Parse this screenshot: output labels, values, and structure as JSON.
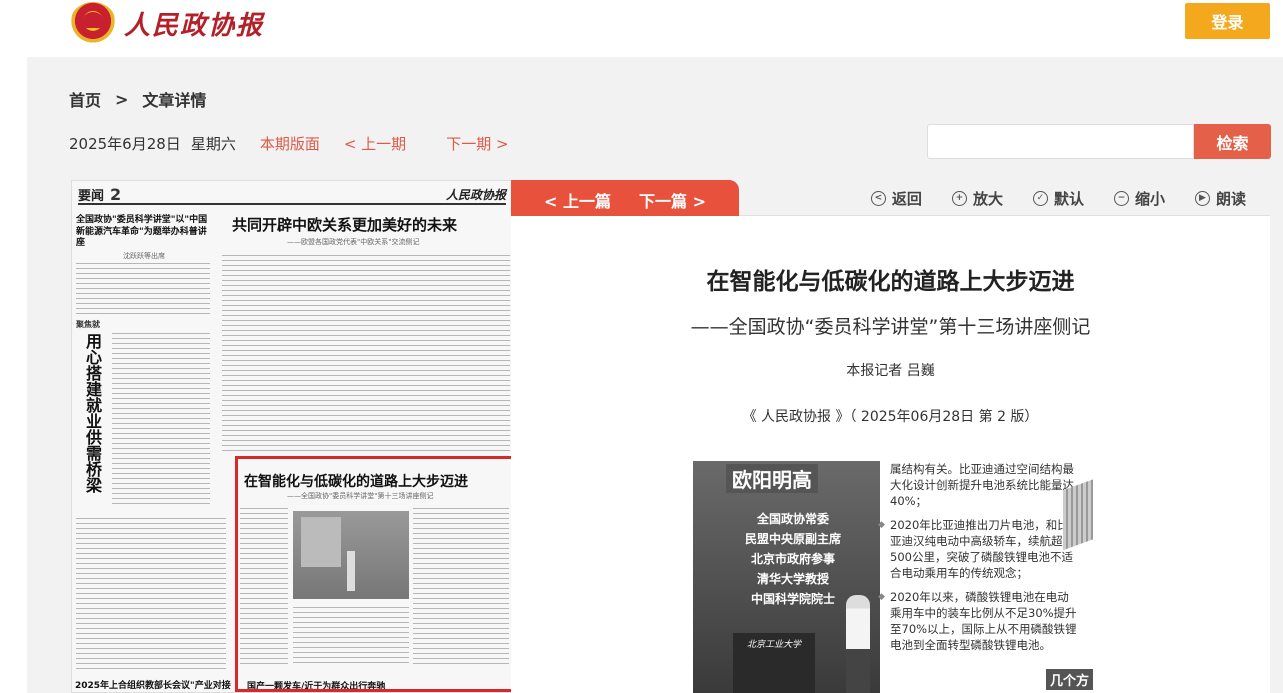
{
  "header": {
    "logo_text": "人民政协报",
    "login_label": "登录"
  },
  "breadcrumb": {
    "home": "首页",
    "separator": ">",
    "current": "文章详情"
  },
  "datebar": {
    "date": "2025年6月28日",
    "weekday": "星期六",
    "layout_link": "本期版面",
    "prev_issue": "< 上一期",
    "next_issue": "下一期 >"
  },
  "search": {
    "placeholder": "",
    "button_label": "检索"
  },
  "paper_page": {
    "section": "要闻",
    "page_number": "2",
    "masthead": "人民政协报",
    "headline_top": "共同开辟中欧关系更加美好的未来",
    "headline_top_sub": "——欧盟各国政党代表\"中欧关系\"交流侧记",
    "left_headline": "全国政协\"委员科学讲堂\"以\"中国新能源汽车革命\"为题举办科普讲座",
    "left_headline_sub": "沈跃跃等出席",
    "tag": "聚焦就",
    "vertical_title": "用心搭建就业供需桥梁",
    "headline_selected": "在智能化与低碳化的道路上大步迈进",
    "headline_selected_sub": "——全国政协\"委员科学讲堂\"第十三场讲座侧记",
    "bottom_left": "2025年上合组织教部长会议\"产业对接",
    "bottom_right": "国产一颗发车/近于为群众出行奔驰"
  },
  "article_toolbar": {
    "prev_article": "< 上一篇",
    "next_article": "下一篇 >",
    "tools": [
      {
        "icon": "back-icon",
        "glyph": "<",
        "label": "返回"
      },
      {
        "icon": "zoom-in-icon",
        "glyph": "+",
        "label": "放大"
      },
      {
        "icon": "default-icon",
        "glyph": "✓",
        "label": "默认"
      },
      {
        "icon": "zoom-out-icon",
        "glyph": "−",
        "label": "缩小"
      },
      {
        "icon": "play-icon",
        "glyph": "▶",
        "label": "朗读"
      }
    ]
  },
  "article": {
    "title": "在智能化与低碳化的道路上大步迈进",
    "subtitle": "——全国政协“委员科学讲堂”第十三场讲座侧记",
    "author": "本报记者 吕巍",
    "source": "《 人民政协报 》（ 2025年06月28日 第 2 版）"
  },
  "article_image": {
    "speaker_name": "欧阳明高",
    "speaker_titles": [
      "全国政协常委",
      "民盟中央原副主席",
      "北京市政府参事",
      "清华大学教授",
      "中国科学院院士"
    ],
    "podium_text": "北京工业大学",
    "slide_text_1": "属结构有关。比亚迪通过空间结构最大化设计创新提升电池系统比能量达40%；",
    "slide_text_2": "2020年比亚迪推出刀片电池，和比亚迪汉纯电动中高级轿车，续航超过500公里，突破了磷酸铁锂电池不适合电动乘用车的传统观念；",
    "slide_text_3": "2020年以来，磷酸铁锂电池在电动乘用车中的装车比例从不足30%提升至70%以上，国际上从不用磷酸铁锂电池到全面转型磷酸铁锂电池。",
    "slide_tail": "几个方"
  }
}
